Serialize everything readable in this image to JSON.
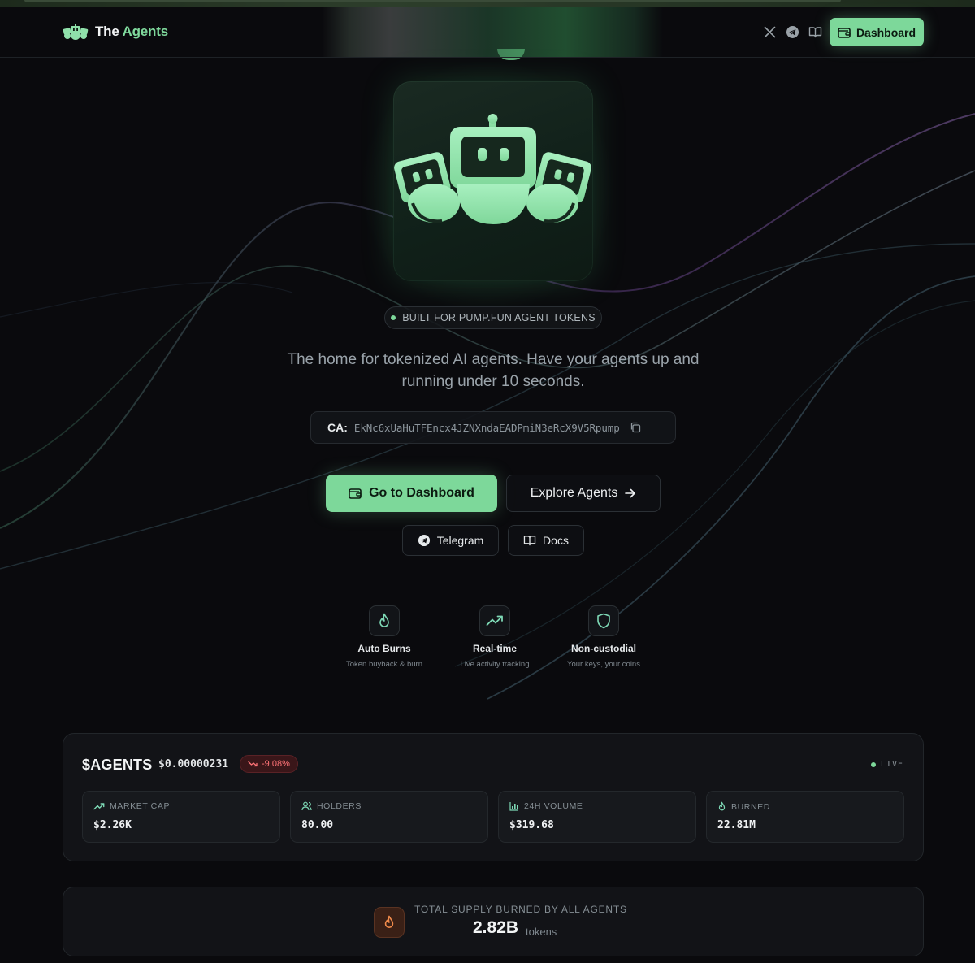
{
  "header": {
    "brand_prefix": "The",
    "brand_accent": "Agents",
    "icons": [
      "x-icon",
      "telegram-icon",
      "book-icon"
    ],
    "dashboard_label": "Dashboard"
  },
  "hero": {
    "badge": "BUILT FOR PUMP.FUN AGENT TOKENS",
    "tagline": "The home for tokenized AI agents. Have your agents up and running under 10 seconds.",
    "ca_label": "CA:",
    "ca_value": "EkNc6xUaHuTFEncx4JZNXndaEADPmiN3eRcX9V5Rpump",
    "primary_button": "Go to Dashboard",
    "secondary_button": "Explore Agents",
    "telegram_button": "Telegram",
    "docs_button": "Docs"
  },
  "features": [
    {
      "title": "Auto Burns",
      "subtitle": "Token buyback & burn",
      "icon": "flame-icon"
    },
    {
      "title": "Real-time",
      "subtitle": "Live activity tracking",
      "icon": "trending-up-icon"
    },
    {
      "title": "Non-custodial",
      "subtitle": "Your keys, your coins",
      "icon": "shield-icon"
    }
  ],
  "token": {
    "ticker": "$AGENTS",
    "price": "$0.00000231",
    "change": "-9.08%",
    "status": "LIVE",
    "stats": [
      {
        "label": "MARKET CAP",
        "value": "$2.26K",
        "icon": "trending-up-icon"
      },
      {
        "label": "HOLDERS",
        "value": "80.00",
        "icon": "users-icon"
      },
      {
        "label": "24H VOLUME",
        "value": "$319.68",
        "icon": "bar-chart-icon"
      },
      {
        "label": "BURNED",
        "value": "22.81M",
        "icon": "flame-icon"
      }
    ]
  },
  "supply": {
    "label": "TOTAL SUPPLY BURNED BY ALL AGENTS",
    "value": "2.82B",
    "unit": "tokens"
  },
  "colors": {
    "accent": "#7dd89a",
    "background": "#0a0a0d",
    "negative": "#ff7377",
    "burn": "#f08a4b"
  }
}
